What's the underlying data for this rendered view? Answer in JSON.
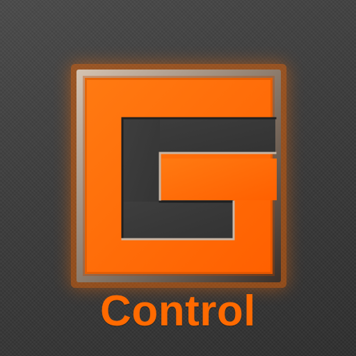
{
  "app": {
    "icon_name": "g-logo-icon",
    "label": "Control"
  },
  "colors": {
    "background": "#3b3b3b",
    "accent": "#ff6a00",
    "bevel_light": "#c9b7a7",
    "bevel_dark": "#1c1c1c"
  }
}
